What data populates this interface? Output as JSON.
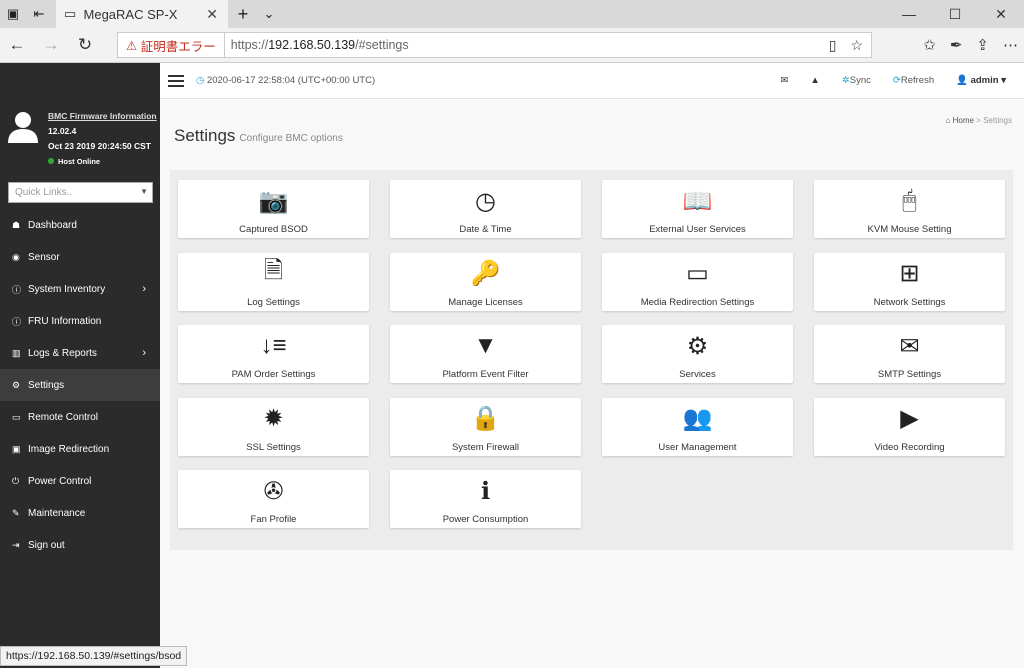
{
  "browser": {
    "tab_title": "MegaRAC SP-X",
    "cert_error": "証明書エラー",
    "url_prefix": "https://",
    "url_host": "192.168.50.139",
    "url_path": "/#settings",
    "status_url": "https://192.168.50.139/#settings/bsod"
  },
  "sidebar": {
    "fw_link": "BMC Firmware Information",
    "version": "12.02.4",
    "build_date": "Oct 23 2019 20:24:50 CST",
    "host_status": "Host Online",
    "quick_links_placeholder": "Quick Links..",
    "items": [
      {
        "label": "Dashboard",
        "icon": "☗"
      },
      {
        "label": "Sensor",
        "icon": "◉"
      },
      {
        "label": "System Inventory",
        "icon": "ⓘ",
        "arrow": true
      },
      {
        "label": "FRU Information",
        "icon": "ⓘ"
      },
      {
        "label": "Logs & Reports",
        "icon": "▥",
        "arrow": true
      },
      {
        "label": "Settings",
        "icon": "⚙"
      },
      {
        "label": "Remote Control",
        "icon": "▭"
      },
      {
        "label": "Image Redirection",
        "icon": "▣"
      },
      {
        "label": "Power Control",
        "icon": "⏻"
      },
      {
        "label": "Maintenance",
        "icon": "✎"
      },
      {
        "label": "Sign out",
        "icon": "⇥"
      }
    ]
  },
  "topbar": {
    "datetime": "2020-06-17 22:58:04 (UTC+00:00 UTC)",
    "sync": "Sync",
    "refresh": "Refresh",
    "user": "admin"
  },
  "page": {
    "title": "Settings",
    "subtitle": "Configure BMC options",
    "breadcrumb_home": "Home",
    "breadcrumb_current": "Settings"
  },
  "cards": [
    {
      "label": "Captured BSOD",
      "icon": "📷"
    },
    {
      "label": "Date & Time",
      "icon": "◷"
    },
    {
      "label": "External User Services",
      "icon": "📖"
    },
    {
      "label": "KVM Mouse Setting",
      "icon": "🖱"
    },
    {
      "label": "Log Settings",
      "icon": "🗎"
    },
    {
      "label": "Manage Licenses",
      "icon": "🔑"
    },
    {
      "label": "Media Redirection Settings",
      "icon": "▭"
    },
    {
      "label": "Network Settings",
      "icon": "⊞"
    },
    {
      "label": "PAM Order Settings",
      "icon": "↓≡"
    },
    {
      "label": "Platform Event Filter",
      "icon": "▼"
    },
    {
      "label": "Services",
      "icon": "⚙"
    },
    {
      "label": "SMTP Settings",
      "icon": "✉"
    },
    {
      "label": "SSL Settings",
      "icon": "✹"
    },
    {
      "label": "System Firewall",
      "icon": "🔒"
    },
    {
      "label": "User Management",
      "icon": "👥"
    },
    {
      "label": "Video Recording",
      "icon": "▶"
    },
    {
      "label": "Fan Profile",
      "icon": "✇"
    },
    {
      "label": "Power Consumption",
      "icon": "ℹ"
    }
  ]
}
